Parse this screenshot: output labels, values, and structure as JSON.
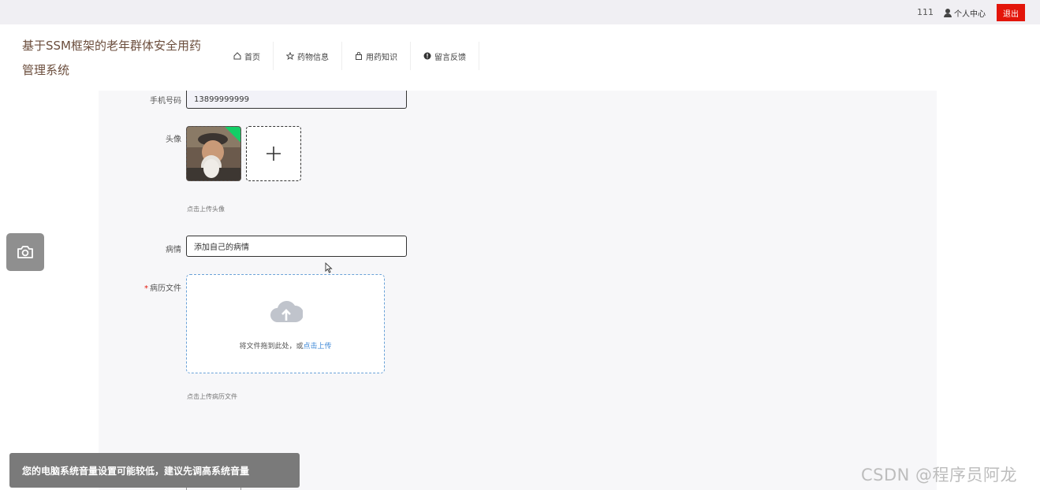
{
  "topbar": {
    "user_id": "111",
    "personal_center": "个人中心",
    "logout": "退出"
  },
  "header": {
    "brand": "基于SSM框架的老年群体安全用药管理系统",
    "nav": [
      {
        "label": "首页",
        "icon": "home-icon"
      },
      {
        "label": "药物信息",
        "icon": "star-icon"
      },
      {
        "label": "用药知识",
        "icon": "bag-icon"
      },
      {
        "label": "留言反馈",
        "icon": "info-icon"
      }
    ]
  },
  "form": {
    "phone_label": "手机号码",
    "phone_value": "13899999999",
    "avatar_label": "头像",
    "avatar_hint": "点击上传头像",
    "condition_label": "病情",
    "condition_value": "添加自己的病情",
    "record_label": "病历文件",
    "record_required": "*",
    "drop_text": "将文件拖到此处，或",
    "drop_link": "点击上传",
    "record_hint": "点击上传病历文件"
  },
  "overlay": {
    "toast": "您的电脑系统音量设置可能较低，建议先调高系统音量",
    "watermark": "CSDN @程序员阿龙"
  },
  "colors": {
    "brand": "#6b4d3c",
    "logout": "#e3150a",
    "link": "#3a86d6",
    "badge": "#13ce66"
  }
}
